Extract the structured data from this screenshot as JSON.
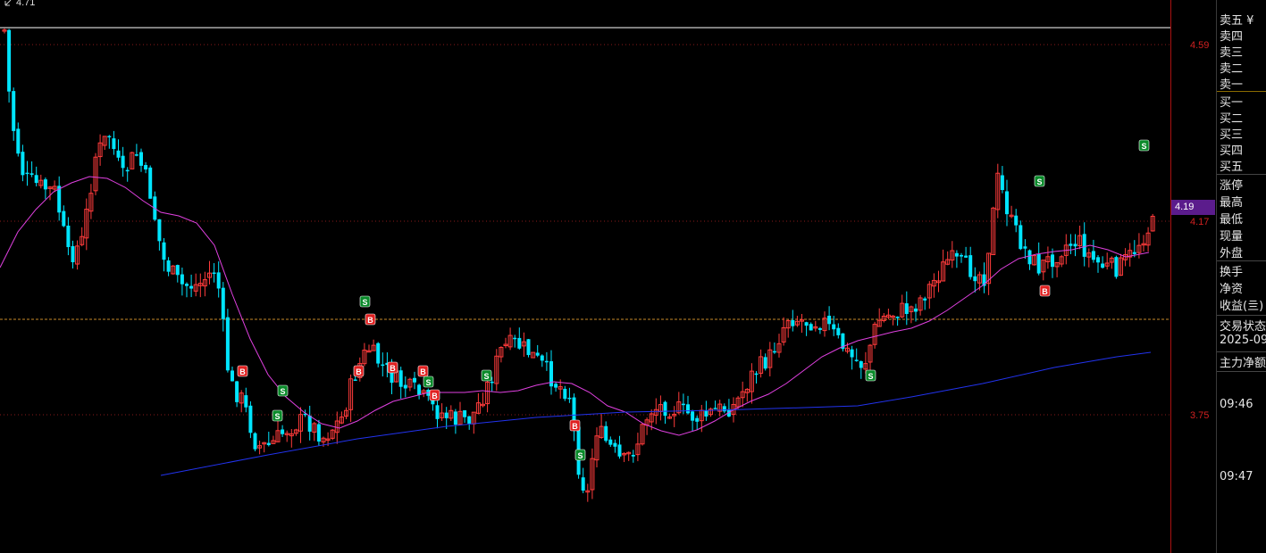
{
  "chart": {
    "top_label": "4.71",
    "price_ticks": [
      "4.59",
      "4.17",
      "3.75"
    ],
    "current_price": "4.19",
    "marker_buy": "B",
    "marker_sell": "S",
    "colors": {
      "up": "#ff3b3b",
      "down": "#00e5ff",
      "ma_short": "#e040e0",
      "ma_long": "#2233ee",
      "grid_dotted": "#8a1a1a",
      "white_line": "#ffffff",
      "orange_line": "#c98a2a"
    }
  },
  "panel": {
    "sell_rows": [
      "卖五 ¥",
      "卖四",
      "卖三",
      "卖二",
      "卖一"
    ],
    "buy_rows": [
      "买一",
      "买二",
      "买三",
      "买四",
      "买五"
    ],
    "stats_a": [
      "涨停",
      "最高",
      "最低",
      "现量",
      "外盘"
    ],
    "stats_b": [
      "换手",
      "净资",
      "收益(亖)"
    ],
    "trade_status": "交易状态",
    "date": "2025-09",
    "main_flow": "主力净额",
    "time_1": "09:46",
    "time_2": "09:47"
  },
  "chart_data": {
    "type": "candlestick",
    "y_ticks": [
      4.59,
      4.17,
      3.75
    ],
    "y_range": [
      3.53,
      4.73
    ],
    "current": 4.19
  }
}
